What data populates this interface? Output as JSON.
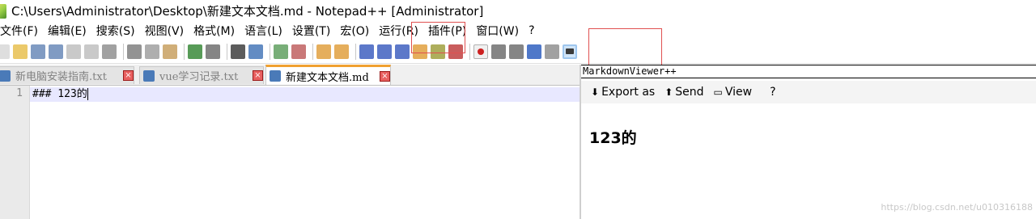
{
  "window": {
    "title": "C:\\Users\\Administrator\\Desktop\\新建文本文档.md - Notepad++ [Administrator]"
  },
  "menu": [
    "文件(F)",
    "编辑(E)",
    "搜索(S)",
    "视图(V)",
    "格式(M)",
    "语言(L)",
    "设置(T)",
    "宏(O)",
    "运行(R)",
    "插件(P)",
    "窗口(W)",
    "?"
  ],
  "toolbar": {
    "buttons": [
      {
        "name": "new-file-icon",
        "color": "#d8d8d8"
      },
      {
        "name": "open-file-icon",
        "color": "#e8c050"
      },
      {
        "name": "save-icon",
        "color": "#6a8ab8"
      },
      {
        "name": "save-all-icon",
        "color": "#6a8ab8"
      },
      {
        "name": "close-icon",
        "color": "#c0c0c0"
      },
      {
        "name": "close-all-icon",
        "color": "#c0c0c0"
      },
      {
        "name": "print-icon",
        "color": "#909090"
      },
      {
        "sep": true
      },
      {
        "name": "cut-icon",
        "color": "#808080"
      },
      {
        "name": "copy-icon",
        "color": "#a0a0a0"
      },
      {
        "name": "paste-icon",
        "color": "#c8a060"
      },
      {
        "sep": true
      },
      {
        "name": "undo-icon",
        "color": "#3a8a3a"
      },
      {
        "name": "redo-icon",
        "color": "#707070"
      },
      {
        "sep": true
      },
      {
        "name": "find-icon",
        "color": "#404040"
      },
      {
        "name": "replace-icon",
        "color": "#4878b8"
      },
      {
        "sep": true
      },
      {
        "name": "zoom-in-icon",
        "color": "#60a060"
      },
      {
        "name": "zoom-out-icon",
        "color": "#c06060"
      },
      {
        "sep": true
      },
      {
        "name": "sync-vertical-icon",
        "color": "#e0a040"
      },
      {
        "name": "sync-horizontal-icon",
        "color": "#e0a040"
      },
      {
        "sep": true
      },
      {
        "name": "word-wrap-icon",
        "color": "#4060c0"
      },
      {
        "name": "show-all-chars-icon",
        "color": "#4060c0"
      },
      {
        "name": "indent-guide-icon",
        "color": "#4060c0"
      },
      {
        "name": "function-list-icon",
        "color": "#e0a040"
      },
      {
        "name": "document-map-icon",
        "color": "#a0a040"
      },
      {
        "name": "folder-workspace-icon",
        "color": "#c04040"
      },
      {
        "sep": true
      },
      {
        "name": "record-macro-icon",
        "color": "#cc2020"
      },
      {
        "name": "stop-macro-icon",
        "color": "#707070"
      },
      {
        "name": "play-macro-icon",
        "color": "#707070"
      },
      {
        "name": "run-macro-multiple-icon",
        "color": "#3060c0"
      },
      {
        "name": "save-macro-icon",
        "color": "#909090"
      },
      {
        "name": "markdown-viewer-icon",
        "color": "#3a3a3a"
      }
    ]
  },
  "tabs": [
    {
      "label": "新电脑安装指南.txt",
      "icon_color": "#4a7ab8",
      "active": false
    },
    {
      "label": "vue学习记录.txt",
      "icon_color": "#4a7ab8",
      "active": false
    },
    {
      "label": "新建文本文档.md",
      "icon_color": "#4a7ab8",
      "active": true
    }
  ],
  "editor": {
    "line_number": "1",
    "line_text": "### 123的"
  },
  "markdown_viewer": {
    "title": "MarkdownViewer++",
    "export_label": "Export as",
    "send_label": "Send",
    "view_label": "View",
    "help_label": "?",
    "rendered_heading": "123的"
  },
  "watermark": "https://blog.csdn.net/u010316188"
}
